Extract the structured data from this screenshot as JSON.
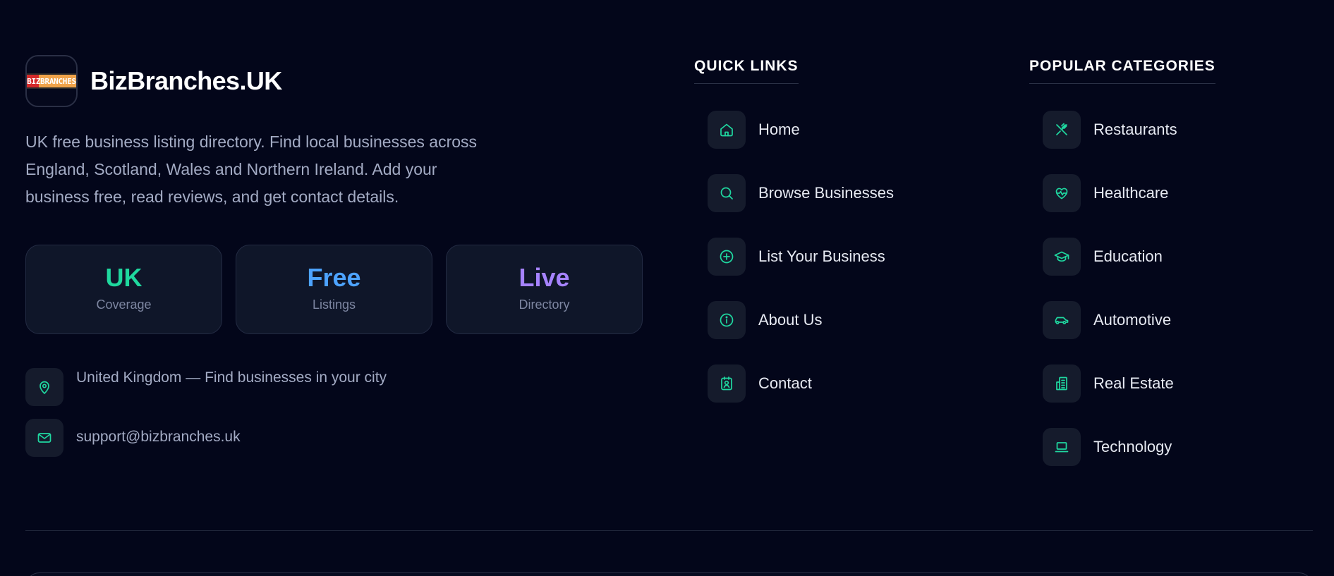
{
  "brand": {
    "logo_text": "BIZBRANCHES",
    "name": "BizBranches.UK"
  },
  "description": "UK free business listing directory. Find local businesses across England, Scotland, Wales and Northern Ireland. Add your business free, read reviews, and get contact details.",
  "stats": [
    {
      "value": "UK",
      "label": "Coverage",
      "color": "#1fd89e"
    },
    {
      "value": "Free",
      "label": "Listings",
      "color": "#4da3ff"
    },
    {
      "value": "Live",
      "label": "Directory",
      "color": "#a683ff"
    }
  ],
  "contact": {
    "location": "United Kingdom — Find businesses in your city",
    "email": "support@bizbranches.uk"
  },
  "quick_links": {
    "title": "QUICK LINKS",
    "items": [
      {
        "label": "Home",
        "icon": "home-icon"
      },
      {
        "label": "Browse Businesses",
        "icon": "search-icon"
      },
      {
        "label": "List Your Business",
        "icon": "plus-circle-icon"
      },
      {
        "label": "About Us",
        "icon": "info-icon"
      },
      {
        "label": "Contact",
        "icon": "contact-card-icon"
      }
    ]
  },
  "categories": {
    "title": "POPULAR CATEGORIES",
    "items": [
      {
        "label": "Restaurants",
        "icon": "utensils-icon"
      },
      {
        "label": "Healthcare",
        "icon": "heart-pulse-icon"
      },
      {
        "label": "Education",
        "icon": "graduation-cap-icon"
      },
      {
        "label": "Automotive",
        "icon": "car-icon"
      },
      {
        "label": "Real Estate",
        "icon": "building-icon"
      },
      {
        "label": "Technology",
        "icon": "laptop-icon"
      }
    ]
  },
  "colors": {
    "background": "#03061a",
    "accent": "#1fd8a0",
    "card": "#0f1629"
  }
}
